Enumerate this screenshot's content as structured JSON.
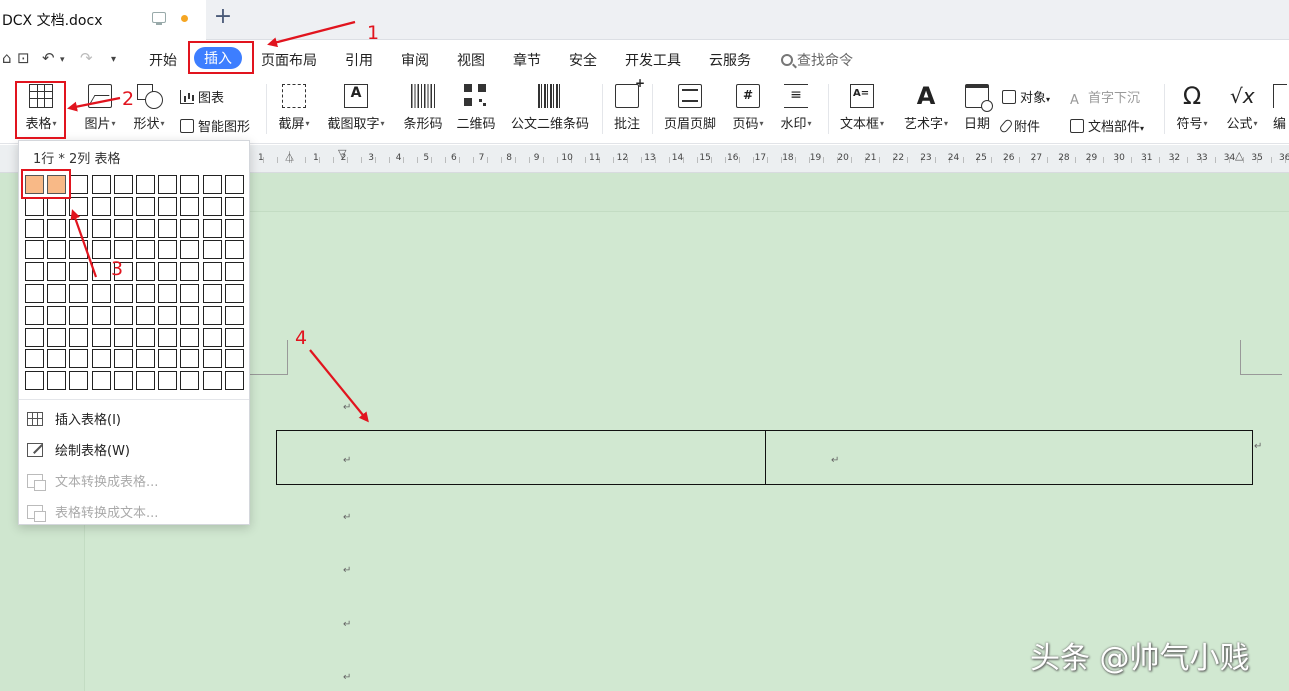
{
  "tab": {
    "title": "DCX 文档.docx"
  },
  "menu": {
    "items": [
      "开始",
      "插入",
      "页面布局",
      "引用",
      "审阅",
      "视图",
      "章节",
      "安全",
      "开发工具",
      "云服务"
    ],
    "active": "插入",
    "search": "查找命令"
  },
  "ribbon": {
    "table": "表格",
    "picture": "图片",
    "shape": "形状",
    "chart": "图表",
    "smartart": "智能图形",
    "screenshot": "截屏",
    "ocr": "截图取字",
    "barcode": "条形码",
    "qrcode": "二维码",
    "doc_barcode": "公文二维条码",
    "comment": "批注",
    "header_footer": "页眉页脚",
    "page_number": "页码",
    "watermark": "水印",
    "textbox": "文本框",
    "wordart": "艺术字",
    "date": "日期",
    "object": "对象",
    "attachment": "附件",
    "dropcap": "首字下沉",
    "doc_parts": "文档部件",
    "symbol": "符号",
    "formula": "公式",
    "edit": "编"
  },
  "ruler": {
    "numbers": [
      "1",
      "1",
      "2",
      "3",
      "4",
      "5",
      "6",
      "7",
      "8",
      "9",
      "10",
      "11",
      "12",
      "13",
      "14",
      "15",
      "16",
      "17",
      "18",
      "19",
      "20",
      "21",
      "22",
      "23",
      "24",
      "25",
      "26",
      "27",
      "28",
      "29",
      "30",
      "31",
      "32",
      "33",
      "34",
      "35",
      "36"
    ]
  },
  "dropdown": {
    "header": "1行 * 2列 表格",
    "grid": {
      "rows": 10,
      "cols": 10,
      "selected_rows": 1,
      "selected_cols": 2
    },
    "items": [
      {
        "label": "插入表格(I)",
        "enabled": true
      },
      {
        "label": "绘制表格(W)",
        "enabled": true
      },
      {
        "label": "文本转换成表格...",
        "enabled": false
      },
      {
        "label": "表格转换成文本...",
        "enabled": false
      }
    ]
  },
  "document": {
    "paragraph_mark": "↵"
  },
  "annotations": [
    "1",
    "2",
    "3",
    "4"
  ],
  "watermark_text": "头条 @帅气小贱",
  "colors": {
    "accent": "#3d7eff",
    "annotation": "#e1141e",
    "page_bg": "#d1e8d1",
    "cell_selected": "#f8b987"
  }
}
